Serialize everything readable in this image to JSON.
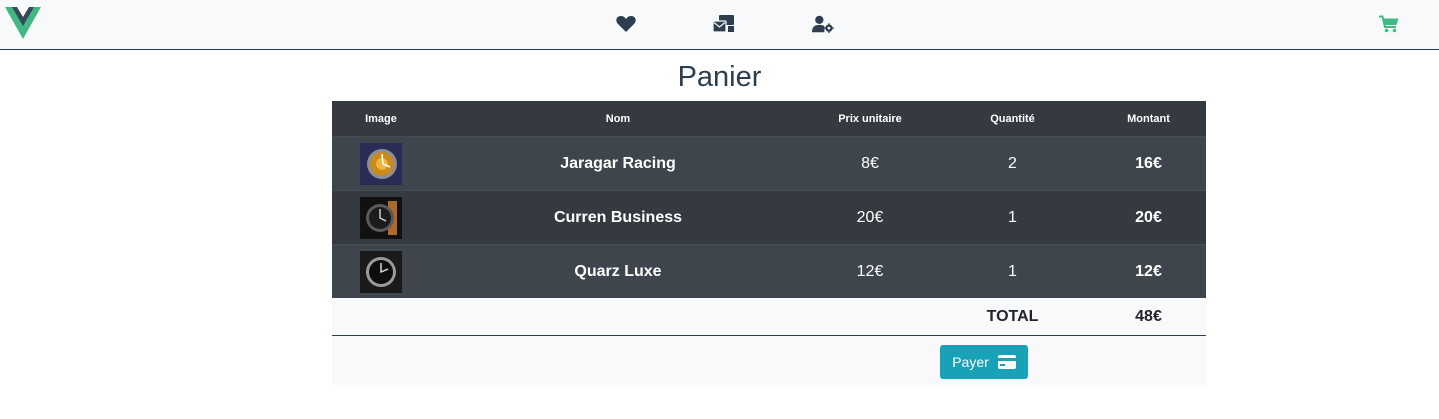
{
  "colors": {
    "brand_green": "#41b883",
    "brand_dark": "#34495e",
    "nav_text": "#2c3e50",
    "cart_icon": "#42b983",
    "pay_button": "#17a2b8"
  },
  "navbar": {
    "logo": "vue-logo",
    "icons": [
      "heart-icon",
      "mail-bulk-icon",
      "user-cog-icon",
      "shopping-cart-icon"
    ]
  },
  "page": {
    "title": "Panier"
  },
  "cart": {
    "headers": {
      "image": "Image",
      "name": "Nom",
      "unit_price": "Prix unitaire",
      "quantity": "Quantité",
      "amount": "Montant"
    },
    "items": [
      {
        "image": "watch-thumbnail",
        "name": "Jaragar Racing",
        "unit_price": "8€",
        "quantity": "2",
        "amount": "16€"
      },
      {
        "image": "watch-thumbnail",
        "name": "Curren Business",
        "unit_price": "20€",
        "quantity": "1",
        "amount": "20€"
      },
      {
        "image": "watch-thumbnail",
        "name": "Quarz Luxe",
        "unit_price": "12€",
        "quantity": "1",
        "amount": "12€"
      }
    ],
    "total_label": "TOTAL",
    "total_value": "48€",
    "pay_label": "Payer"
  }
}
